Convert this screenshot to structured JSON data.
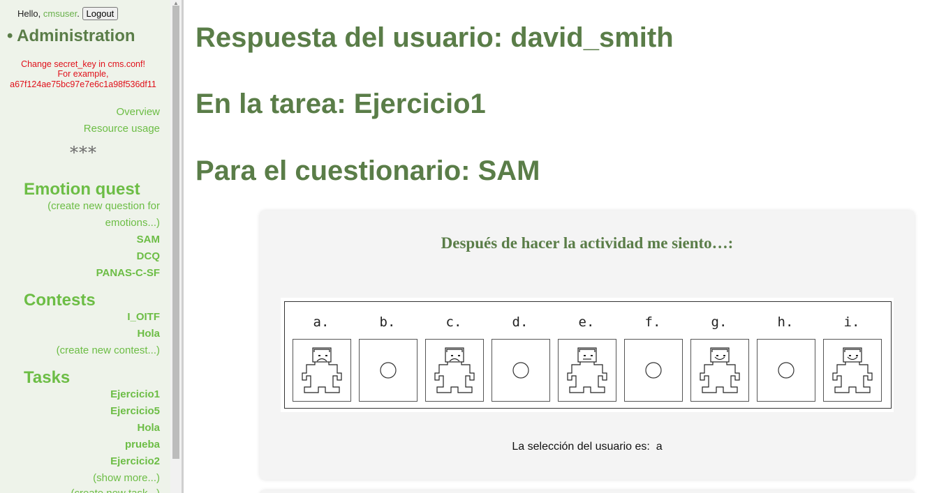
{
  "sidebar": {
    "greeting": "Hello,",
    "username": "cmsuser",
    "greeting_period": ".",
    "logout_label": "Logout",
    "admin_title": "• Administration",
    "warning": {
      "line1": "Change secret_key in cms.conf!",
      "line2": "For example,",
      "line3": "a67f124ae75bc97e7e6c1a98f536df11"
    },
    "overview": "Overview",
    "resource_usage": "Resource usage",
    "stars": "***",
    "emotion": {
      "title": "Emotion quest",
      "create_line1": "(create new question for",
      "create_line2": "emotions...)",
      "items": [
        "SAM",
        "DCQ",
        "PANAS-C-SF"
      ]
    },
    "contests": {
      "title": "Contests",
      "items": [
        "I_OITF",
        "Hola"
      ],
      "create": "(create new contest...)"
    },
    "tasks": {
      "title": "Tasks",
      "items": [
        "Ejercicio1",
        "Ejercicio5",
        "Hola",
        "prueba",
        "Ejercicio2"
      ],
      "show_more": "(show more...)",
      "create": "(create new task...)"
    }
  },
  "main": {
    "heading_user": "Respuesta del usuario: david_smith",
    "heading_task": "En la tarea: Ejercicio1",
    "heading_quiz": "Para el cuestionario: SAM",
    "question": "Después de hacer la actividad me siento…:",
    "options": [
      {
        "letter": "a.",
        "kind": "figure",
        "mood": "sad"
      },
      {
        "letter": "b.",
        "kind": "circle"
      },
      {
        "letter": "c.",
        "kind": "figure",
        "mood": "sad"
      },
      {
        "letter": "d.",
        "kind": "circle"
      },
      {
        "letter": "e.",
        "kind": "figure",
        "mood": "neutral"
      },
      {
        "letter": "f.",
        "kind": "circle"
      },
      {
        "letter": "g.",
        "kind": "figure",
        "mood": "happy"
      },
      {
        "letter": "h.",
        "kind": "circle"
      },
      {
        "letter": "i.",
        "kind": "figure",
        "mood": "happy"
      }
    ],
    "selection_label": "La selección del usuario es:",
    "selection_value": "a"
  }
}
